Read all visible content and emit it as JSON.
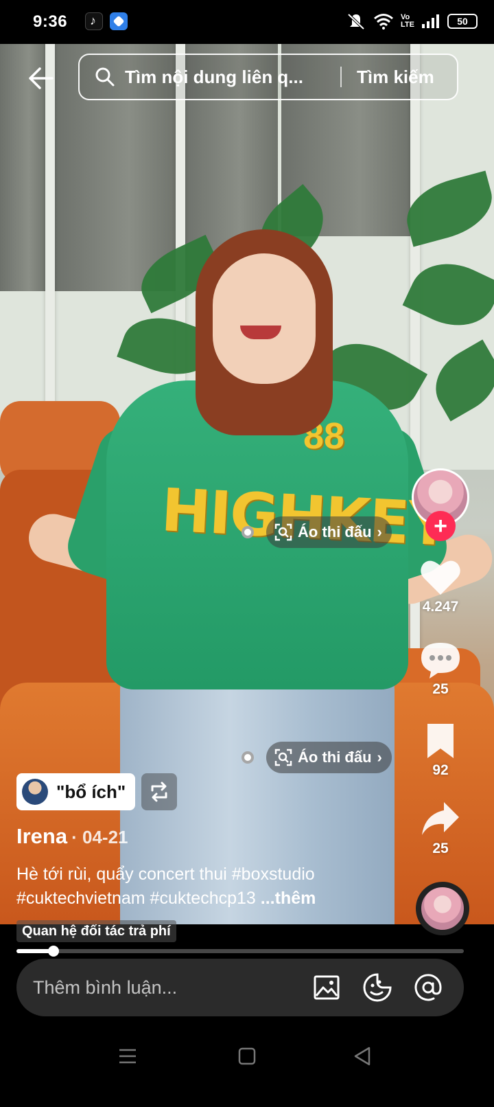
{
  "status_bar": {
    "time": "9:36",
    "app_icons": [
      "tiktok-icon",
      "blue-app-icon"
    ],
    "indicators": [
      "mute-icon",
      "wifi-icon",
      "volte-icon",
      "signal-icon"
    ],
    "volte_label": "Vo\nLTE",
    "battery": "50"
  },
  "search": {
    "placeholder": "Tìm nội dung liên q...",
    "button_label": "Tìm kiếm"
  },
  "product_tags": [
    {
      "label": "Áo thi đấu"
    },
    {
      "label": "Áo thi đấu"
    }
  ],
  "video_overlay_text": {
    "jersey_text": "HIGHKEY",
    "jersey_number": "88"
  },
  "right_rail": {
    "likes": "4.247",
    "comments": "25",
    "saves": "92",
    "shares": "25"
  },
  "reply": {
    "text": "\"bổ ích\""
  },
  "post": {
    "author": "Irena",
    "date": "· 04-21",
    "caption": "Hè tới rùi, quẩy concert thui #boxstudio #cuktechvietnam #cuktechcp13",
    "more_label": "...thêm",
    "partner_label": "Quan hệ đối tác trả phí"
  },
  "playback": {
    "progress": 0.083
  },
  "comment_bar": {
    "placeholder": "Thêm bình luận..."
  },
  "nav": {
    "buttons": [
      "menu-icon",
      "home-icon",
      "back-icon"
    ]
  },
  "colors": {
    "follow_accent": "#fe2c55",
    "jersey_green": "#2aa06a",
    "jersey_yellow": "#f2c530",
    "comment_bar_bg": "#2b2b2b"
  }
}
